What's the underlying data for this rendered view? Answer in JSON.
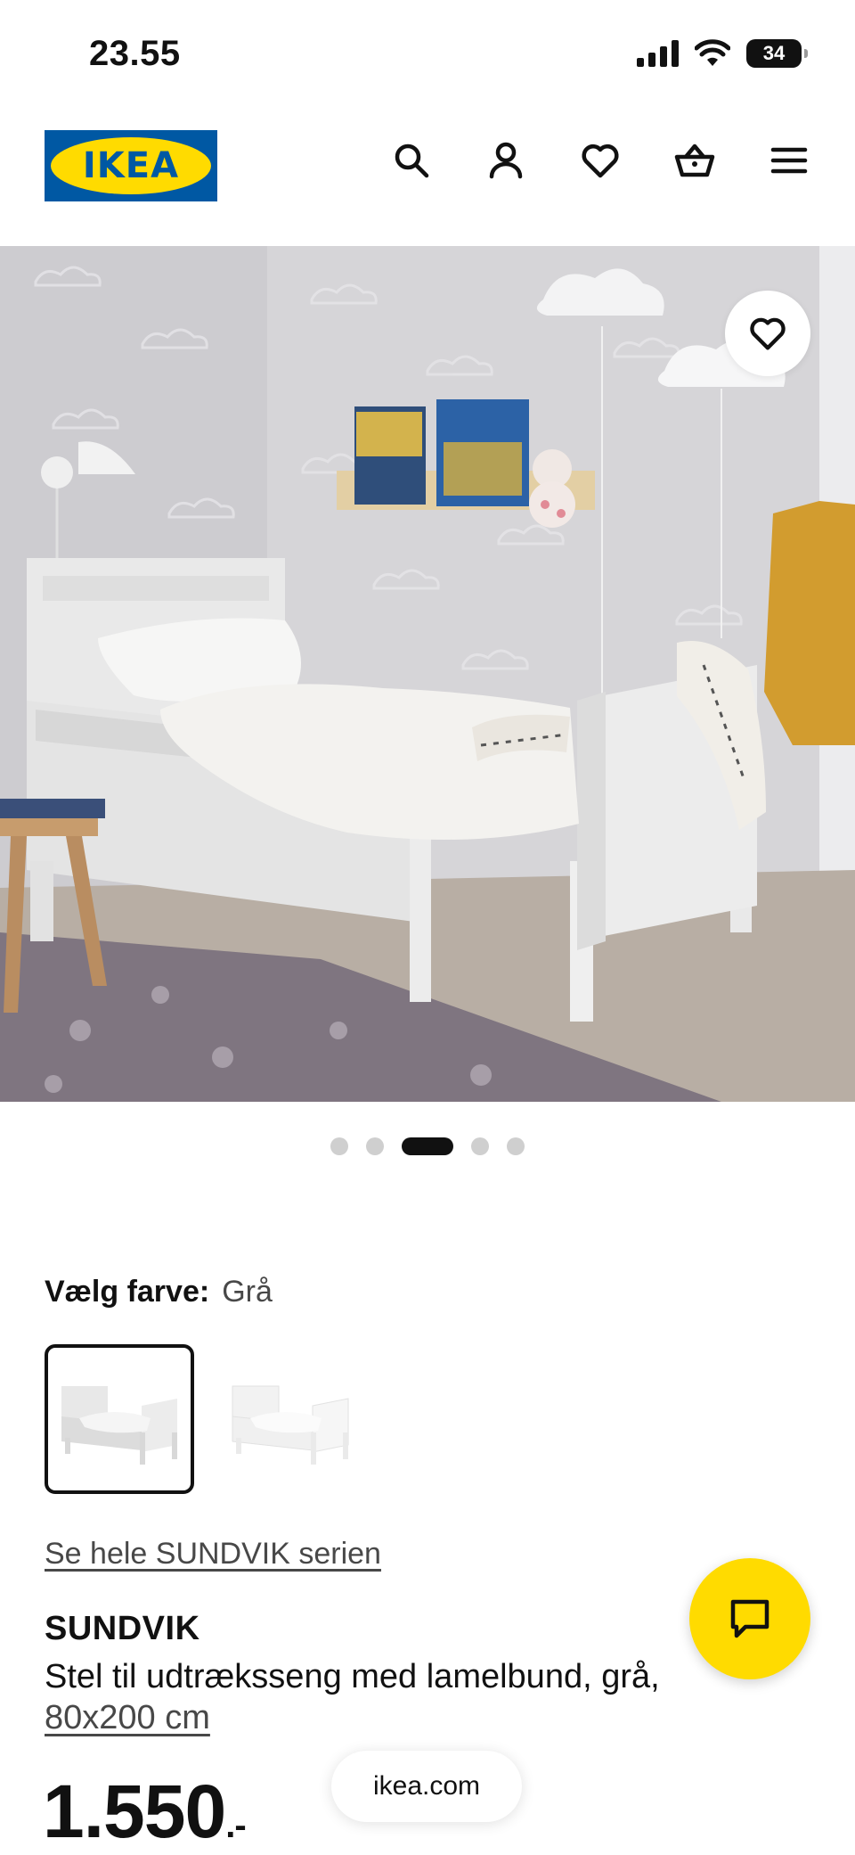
{
  "status_bar": {
    "time": "23.55",
    "battery": "34"
  },
  "header": {
    "logo_text": "IKEA",
    "icons": [
      "search-icon",
      "account-icon",
      "heart-icon",
      "basket-icon",
      "menu-icon"
    ]
  },
  "gallery": {
    "total_images": 5,
    "active_index": 2,
    "favourite_icon": "heart-icon"
  },
  "color_picker": {
    "label": "Vælg farve:",
    "selected": "Grå",
    "option_count": 2
  },
  "product": {
    "series_link": "Se hele SUNDVIK serien",
    "name": "SUNDVIK",
    "description": "Stel til udtræksseng med lamelbund, grå,",
    "size": "80x200 cm",
    "price": "1.550",
    "price_suffix": ".-"
  },
  "chat": {
    "icon": "chat-icon"
  },
  "browser": {
    "url": "ikea.com"
  },
  "colors": {
    "ikea_blue": "#0058a3",
    "ikea_yellow": "#ffdb00",
    "text": "#111111",
    "muted": "#484848"
  }
}
